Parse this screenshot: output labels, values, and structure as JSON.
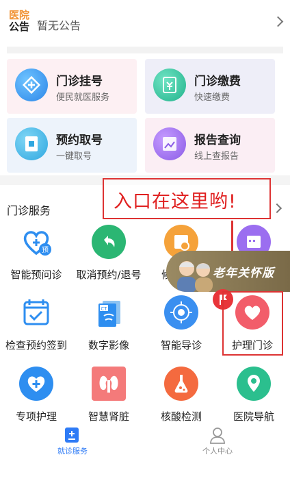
{
  "notice": {
    "logo_line1": "医院",
    "logo_line2": "公告",
    "text": "暂无公告"
  },
  "cards": [
    {
      "title": "门诊挂号",
      "subtitle": "便民就医服务"
    },
    {
      "title": "门诊缴费",
      "subtitle": "快速缴费"
    },
    {
      "title": "预约取号",
      "subtitle": "一键取号"
    },
    {
      "title": "报告查询",
      "subtitle": "线上查报告"
    }
  ],
  "section": {
    "title": "门诊服务"
  },
  "callout": {
    "text": "入口在这里哟!"
  },
  "elder_mode": {
    "label": "老年关怀版"
  },
  "services": [
    {
      "label": "智能预问诊",
      "icon": "stethoscope-icon"
    },
    {
      "label": "取消预约/退号",
      "icon": "undo-icon"
    },
    {
      "label": "候",
      "icon": "clock-calendar-icon"
    },
    {
      "label": "",
      "icon": "calendar-icon"
    },
    {
      "label": "检查预约签到",
      "icon": "calendar-check-icon"
    },
    {
      "label": "数字影像",
      "icon": "ct-image-icon"
    },
    {
      "label": "智能导诊",
      "icon": "compass-icon"
    },
    {
      "label": "护理门诊",
      "icon": "heart-icon"
    },
    {
      "label": "专项护理",
      "icon": "medical-cross-icon"
    },
    {
      "label": "智慧肾脏",
      "icon": "kidney-icon"
    },
    {
      "label": "核酸检测",
      "icon": "flask-icon"
    },
    {
      "label": "医院导航",
      "icon": "map-pin-icon"
    }
  ],
  "tabs": [
    {
      "label": "就诊服务",
      "active": true
    },
    {
      "label": "个人中心",
      "active": false
    }
  ],
  "colors": {
    "accent": "#2e7bf6",
    "highlight": "#e02020"
  }
}
